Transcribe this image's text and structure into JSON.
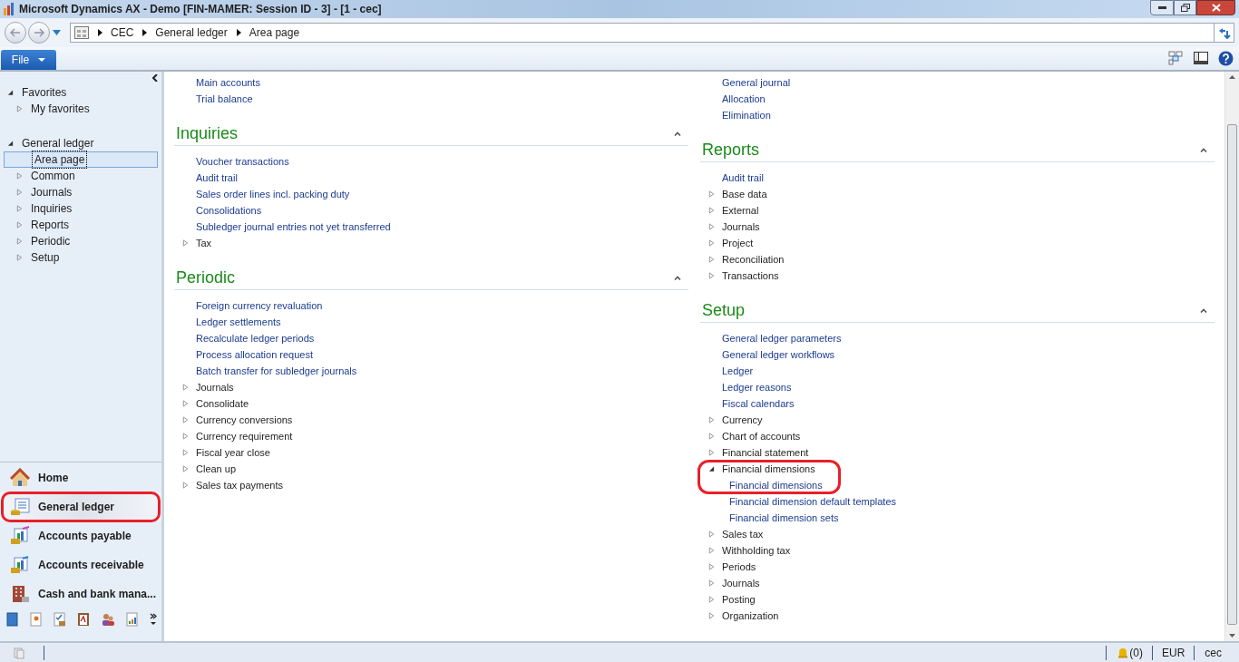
{
  "window": {
    "title": "Microsoft Dynamics AX - Demo [FIN-MAMER: Session ID - 3] -  [1 - cec]"
  },
  "address_bar": {
    "path": [
      "CEC",
      "General ledger",
      "Area page"
    ]
  },
  "ribbon": {
    "file_tab": "File"
  },
  "nav_tree": [
    {
      "label": "Favorites",
      "children": [
        {
          "label": "My favorites",
          "kind": "folder",
          "selected": false
        }
      ]
    },
    {
      "label": "General ledger",
      "children": [
        {
          "label": "Area page",
          "kind": "page",
          "selected": true
        },
        {
          "label": "Common",
          "kind": "folder",
          "selected": false
        },
        {
          "label": "Journals",
          "kind": "folder",
          "selected": false
        },
        {
          "label": "Inquiries",
          "kind": "folder",
          "selected": false
        },
        {
          "label": "Reports",
          "kind": "folder",
          "selected": false
        },
        {
          "label": "Periodic",
          "kind": "folder",
          "selected": false
        },
        {
          "label": "Setup",
          "kind": "folder",
          "selected": false
        }
      ]
    }
  ],
  "modules": [
    {
      "label": "Home",
      "selected": false,
      "highlighted": false
    },
    {
      "label": "General ledger",
      "selected": true,
      "highlighted": true
    },
    {
      "label": "Accounts payable",
      "selected": false,
      "highlighted": false
    },
    {
      "label": "Accounts receivable",
      "selected": false,
      "highlighted": false
    },
    {
      "label": "Cash and bank mana...",
      "selected": false,
      "highlighted": false
    }
  ],
  "columns": [
    [
      {
        "items": [
          {
            "label": "Main accounts",
            "kind": "link"
          },
          {
            "label": "Trial balance",
            "kind": "link"
          }
        ]
      },
      {
        "title": "Inquiries",
        "items": [
          {
            "label": "Voucher transactions",
            "kind": "link"
          },
          {
            "label": "Audit trail",
            "kind": "link"
          },
          {
            "label": "Sales order lines incl. packing duty",
            "kind": "link"
          },
          {
            "label": "Consolidations",
            "kind": "link"
          },
          {
            "label": "Subledger journal entries not yet transferred",
            "kind": "link"
          },
          {
            "label": "Tax",
            "kind": "group",
            "expanded": false
          }
        ]
      },
      {
        "title": "Periodic",
        "items": [
          {
            "label": "Foreign currency revaluation",
            "kind": "link"
          },
          {
            "label": "Ledger settlements",
            "kind": "link"
          },
          {
            "label": "Recalculate ledger periods",
            "kind": "link"
          },
          {
            "label": "Process allocation request",
            "kind": "link"
          },
          {
            "label": "Batch transfer for subledger journals",
            "kind": "link"
          },
          {
            "label": "Journals",
            "kind": "group",
            "expanded": false
          },
          {
            "label": "Consolidate",
            "kind": "group",
            "expanded": false
          },
          {
            "label": "Currency conversions",
            "kind": "group",
            "expanded": false
          },
          {
            "label": "Currency requirement",
            "kind": "group",
            "expanded": false
          },
          {
            "label": "Fiscal year close",
            "kind": "group",
            "expanded": false
          },
          {
            "label": "Clean up",
            "kind": "group",
            "expanded": false
          },
          {
            "label": "Sales tax payments",
            "kind": "group",
            "expanded": false
          }
        ]
      }
    ],
    [
      {
        "items": [
          {
            "label": "General journal",
            "kind": "link"
          },
          {
            "label": "Allocation",
            "kind": "link"
          },
          {
            "label": "Elimination",
            "kind": "link"
          }
        ]
      },
      {
        "title": "Reports",
        "items": [
          {
            "label": "Audit trail",
            "kind": "link"
          },
          {
            "label": "Base data",
            "kind": "group",
            "expanded": false
          },
          {
            "label": "External",
            "kind": "group",
            "expanded": false
          },
          {
            "label": "Journals",
            "kind": "group",
            "expanded": false
          },
          {
            "label": "Project",
            "kind": "group",
            "expanded": false
          },
          {
            "label": "Reconciliation",
            "kind": "group",
            "expanded": false
          },
          {
            "label": "Transactions",
            "kind": "group",
            "expanded": false
          }
        ]
      },
      {
        "title": "Setup",
        "items": [
          {
            "label": "General ledger parameters",
            "kind": "link"
          },
          {
            "label": "General ledger workflows",
            "kind": "link"
          },
          {
            "label": "Ledger",
            "kind": "link"
          },
          {
            "label": "Ledger reasons",
            "kind": "link"
          },
          {
            "label": "Fiscal calendars",
            "kind": "link"
          },
          {
            "label": "Currency",
            "kind": "group",
            "expanded": false
          },
          {
            "label": "Chart of accounts",
            "kind": "group",
            "expanded": false
          },
          {
            "label": "Financial statement",
            "kind": "group",
            "expanded": false
          },
          {
            "label": "Financial dimensions",
            "kind": "group",
            "expanded": true,
            "highlighted": true,
            "children": [
              {
                "label": "Financial dimensions",
                "kind": "link"
              },
              {
                "label": "Financial dimension default templates",
                "kind": "link"
              },
              {
                "label": "Financial dimension sets",
                "kind": "link"
              }
            ]
          },
          {
            "label": "Sales tax",
            "kind": "group",
            "expanded": false
          },
          {
            "label": "Withholding tax",
            "kind": "group",
            "expanded": false
          },
          {
            "label": "Periods",
            "kind": "group",
            "expanded": false
          },
          {
            "label": "Journals",
            "kind": "group",
            "expanded": false
          },
          {
            "label": "Posting",
            "kind": "group",
            "expanded": false
          },
          {
            "label": "Organization",
            "kind": "group",
            "expanded": false
          }
        ]
      }
    ]
  ],
  "status_bar": {
    "notifications": "(0)",
    "currency": "EUR",
    "company": "cec"
  }
}
